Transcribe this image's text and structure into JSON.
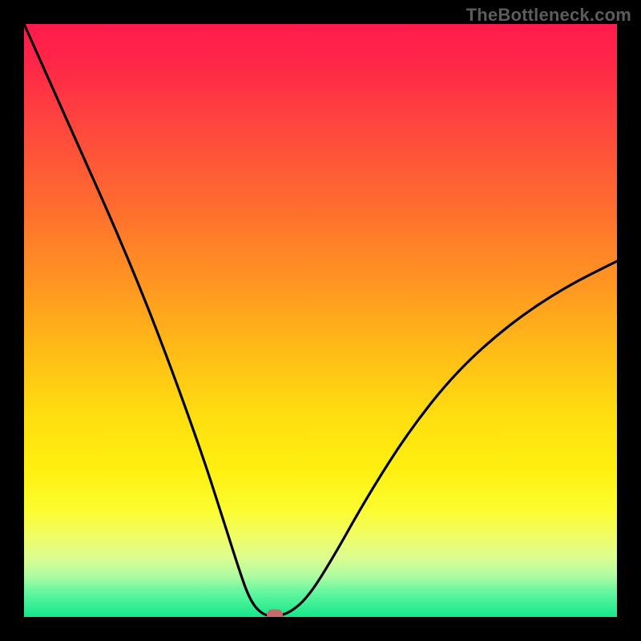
{
  "watermark": "TheBottleneck.com",
  "colors": {
    "frame_bg": "#000000",
    "gradient_top": "#ff1a4d",
    "gradient_bottom": "#14e78a",
    "curve_stroke": "#000000",
    "marker_fill": "#c96a6a"
  },
  "chart_data": {
    "type": "line",
    "title": "",
    "xlabel": "",
    "ylabel": "",
    "xlim": [
      0,
      100
    ],
    "ylim": [
      0,
      100
    ],
    "series": [
      {
        "name": "bottleneck-curve",
        "x": [
          0,
          5,
          10,
          15,
          20,
          25,
          30,
          33,
          36,
          38,
          40,
          42.3,
          45,
          48,
          52,
          58,
          65,
          73,
          82,
          91,
          100
        ],
        "y": [
          100,
          88.8,
          77.6,
          66.4,
          54.5,
          41.5,
          27.5,
          18.3,
          8.8,
          3.0,
          0.5,
          0.0,
          0.8,
          3.5,
          9.8,
          20.5,
          31.5,
          41.5,
          49.5,
          55.5,
          60.0
        ]
      }
    ],
    "marker": {
      "x": 42.3,
      "y": 0.4
    },
    "annotations": []
  }
}
